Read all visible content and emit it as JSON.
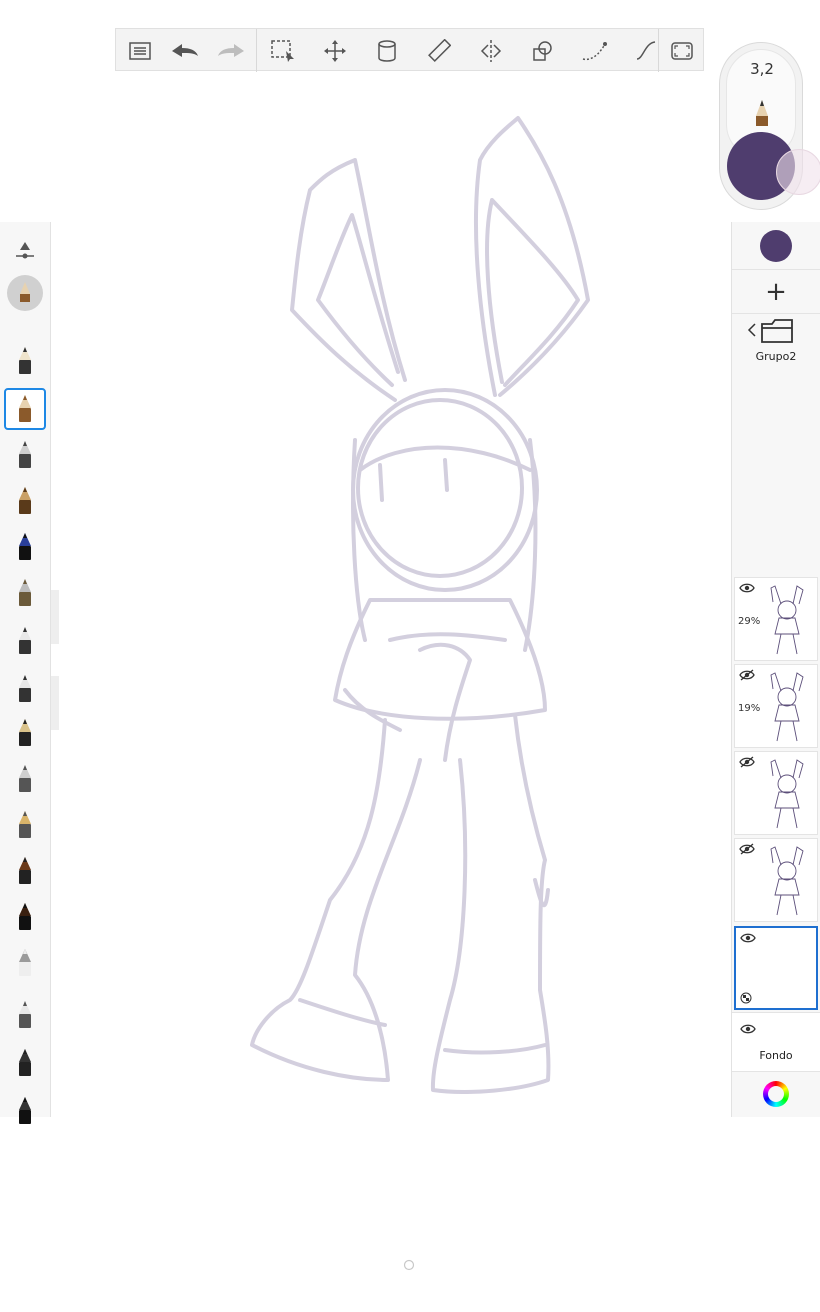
{
  "toolbar": {
    "items": [
      "layers-list",
      "undo",
      "redo",
      "selection",
      "transform",
      "fill",
      "ruler",
      "symmetry",
      "shapes",
      "stroke-curve",
      "predictive-stroke",
      "fullscreen"
    ]
  },
  "brush": {
    "size": "3,2",
    "color": "#4f3d6e"
  },
  "brushes": [
    "brush-properties",
    "airbrush",
    "pencil-light",
    "pencil",
    "ballpoint",
    "fountain-pen",
    "blue-pen",
    "paintbrush-thin",
    "marker",
    "marker-chisel",
    "ink-bottle",
    "technical-pen",
    "nib-pen",
    "paint-brush",
    "ink-brush",
    "felt-tip",
    "marker-wide",
    "eraser",
    "eraser-block"
  ],
  "layers_panel": {
    "current_color": "#4f3d6e",
    "add_label": "+",
    "group_name": "Grupo2",
    "layers": [
      {
        "visible": true,
        "opacity": "29%"
      },
      {
        "visible": false,
        "opacity": "19%"
      },
      {
        "visible": false,
        "opacity": ""
      },
      {
        "visible": false,
        "opacity": ""
      },
      {
        "visible": true,
        "opacity": "",
        "selected": true
      }
    ],
    "background_label": "Fondo"
  },
  "colors": {
    "sketch": "#cfcadb",
    "accent": "#1e6fd0",
    "panel_bg": "#f7f7f7"
  }
}
